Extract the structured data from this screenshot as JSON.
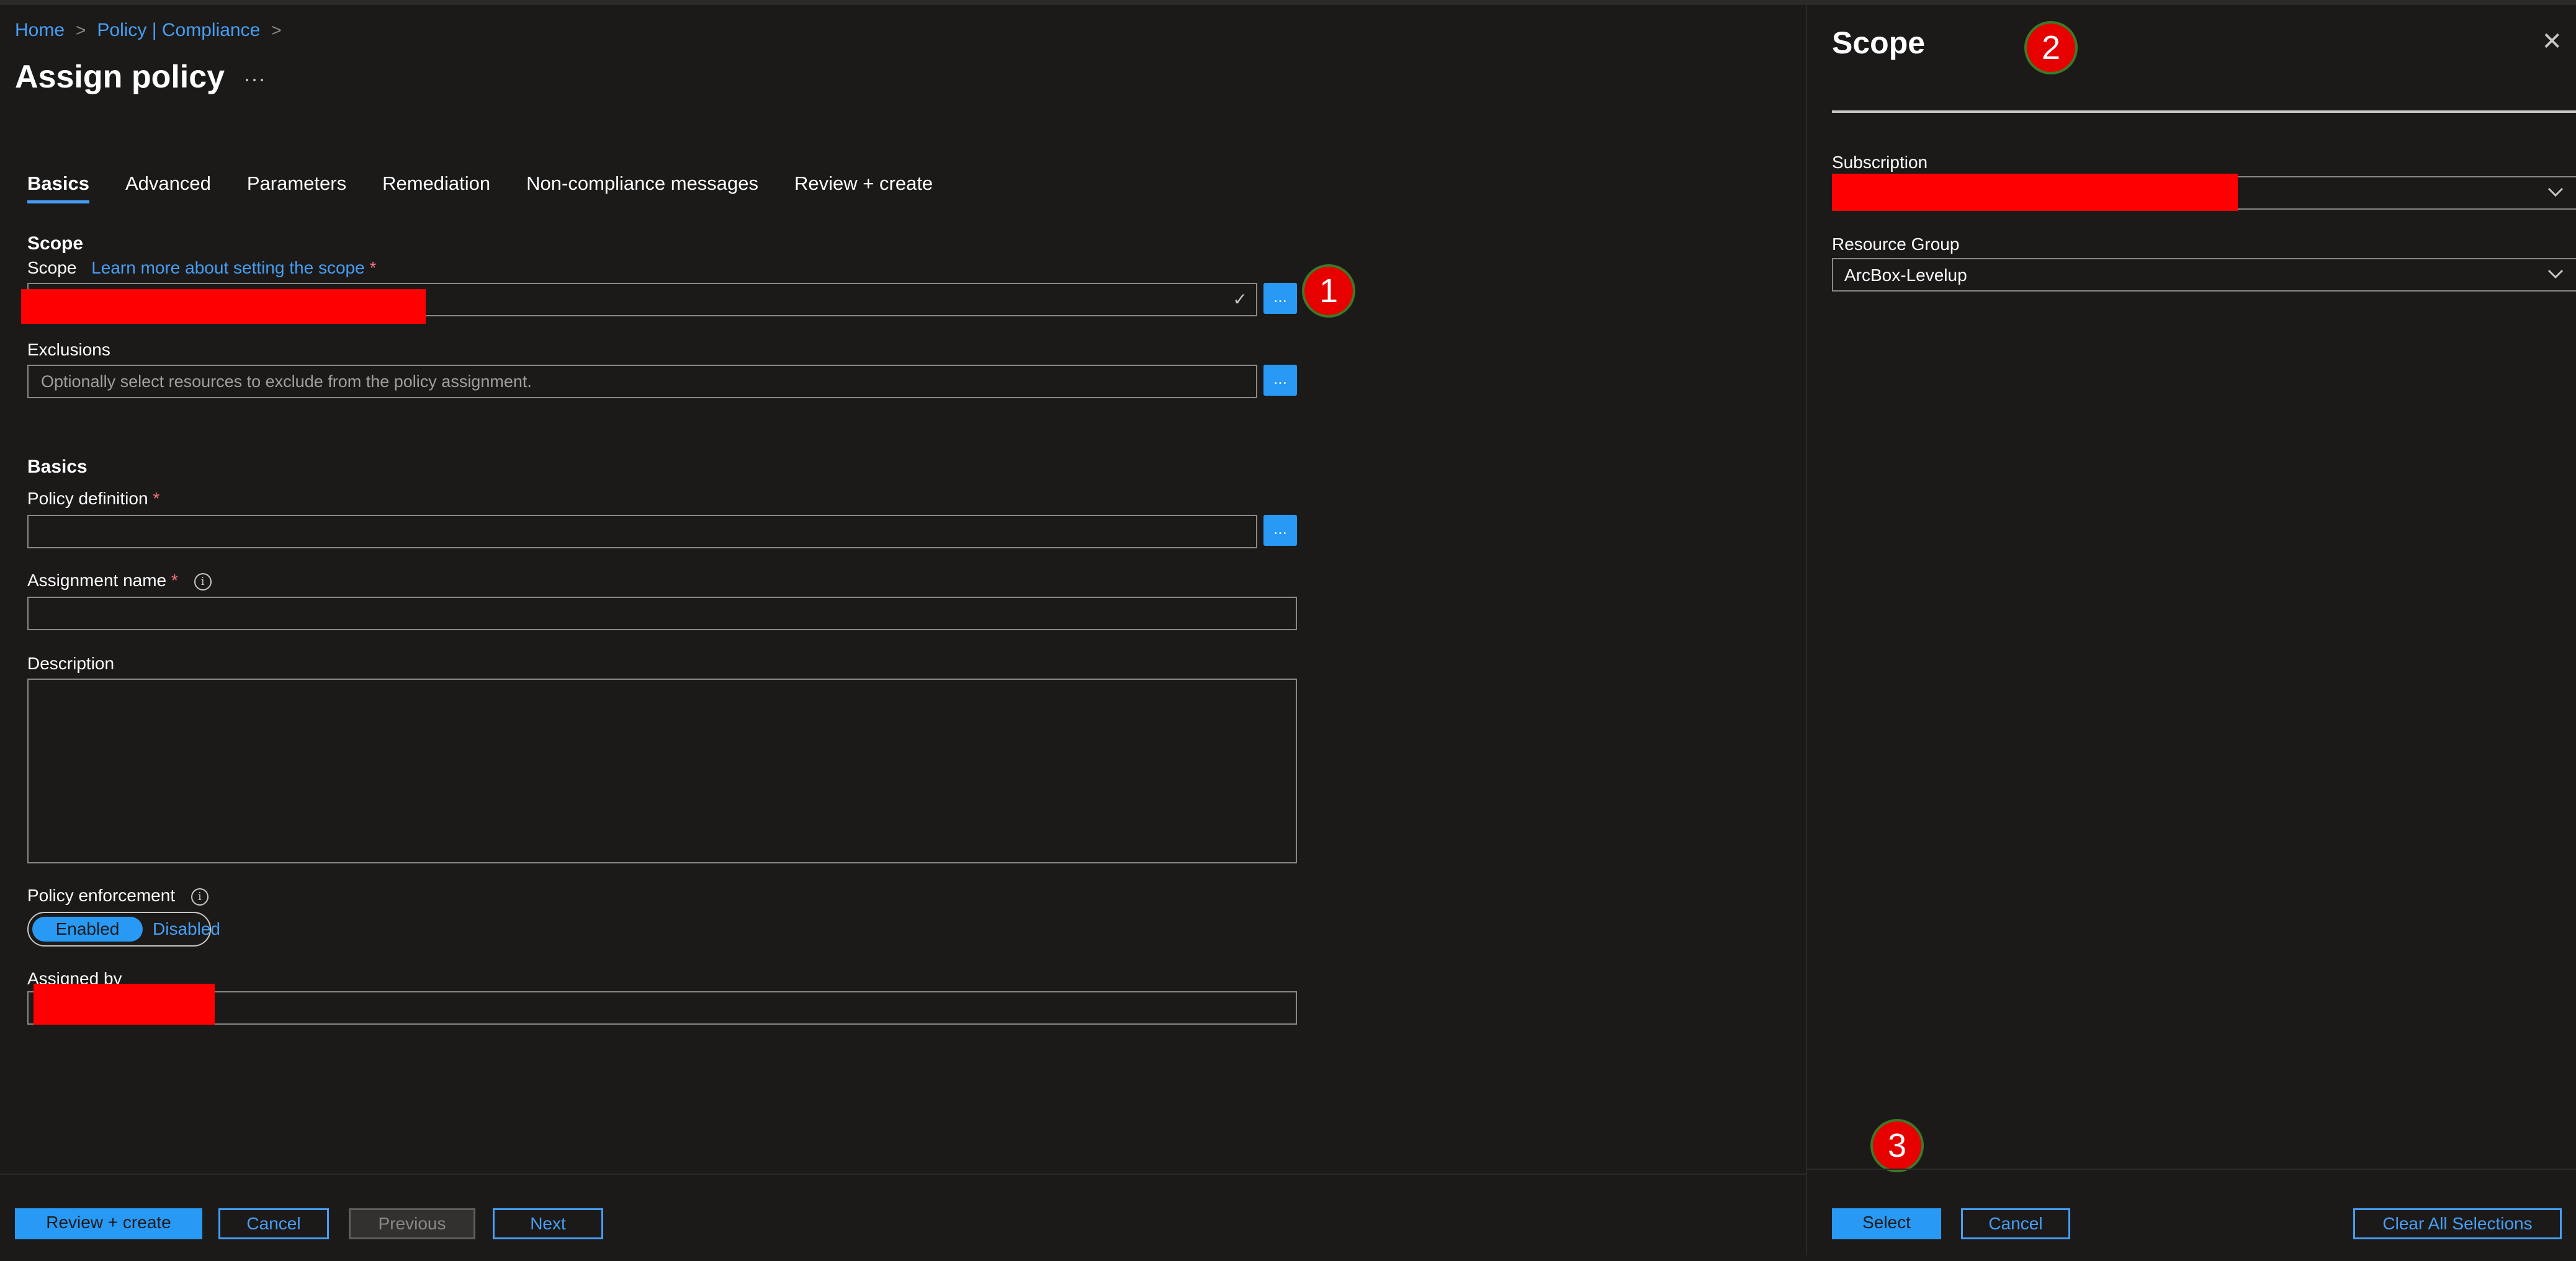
{
  "breadcrumb": {
    "home": "Home",
    "policy": "Policy | Compliance"
  },
  "page": {
    "title": "Assign policy",
    "more": "···"
  },
  "tabs": [
    "Basics",
    "Advanced",
    "Parameters",
    "Remediation",
    "Non-compliance messages",
    "Review + create"
  ],
  "scope_section": {
    "heading": "Scope",
    "scope_label": "Scope",
    "scope_link": "Learn more about setting the scope",
    "required_mark": "*",
    "exclusions_label": "Exclusions",
    "exclusions_placeholder": "Optionally select resources to exclude from the policy assignment.",
    "browse": "..."
  },
  "basics_section": {
    "heading": "Basics",
    "policy_definition_label": "Policy definition",
    "assignment_name_label": "Assignment name",
    "description_label": "Description",
    "enforcement_label": "Policy enforcement",
    "enabled": "Enabled",
    "disabled": "Disabled",
    "assigned_by_label": "Assigned by",
    "info": "i"
  },
  "footer": {
    "review": "Review + create",
    "cancel": "Cancel",
    "previous": "Previous",
    "next": "Next"
  },
  "panel": {
    "title": "Scope",
    "close": "✕",
    "subscription_label": "Subscription",
    "resource_group_label": "Resource Group",
    "resource_group_value": "ArcBox-Levelup",
    "select": "Select",
    "cancel": "Cancel",
    "clear": "Clear All Selections"
  },
  "annotations": [
    "1",
    "2",
    "3"
  ],
  "colors": {
    "accent": "#2899f5",
    "link": "#479ef5",
    "redaction": "#ff0000",
    "required": "#f1707b",
    "background": "#1b1a19"
  }
}
